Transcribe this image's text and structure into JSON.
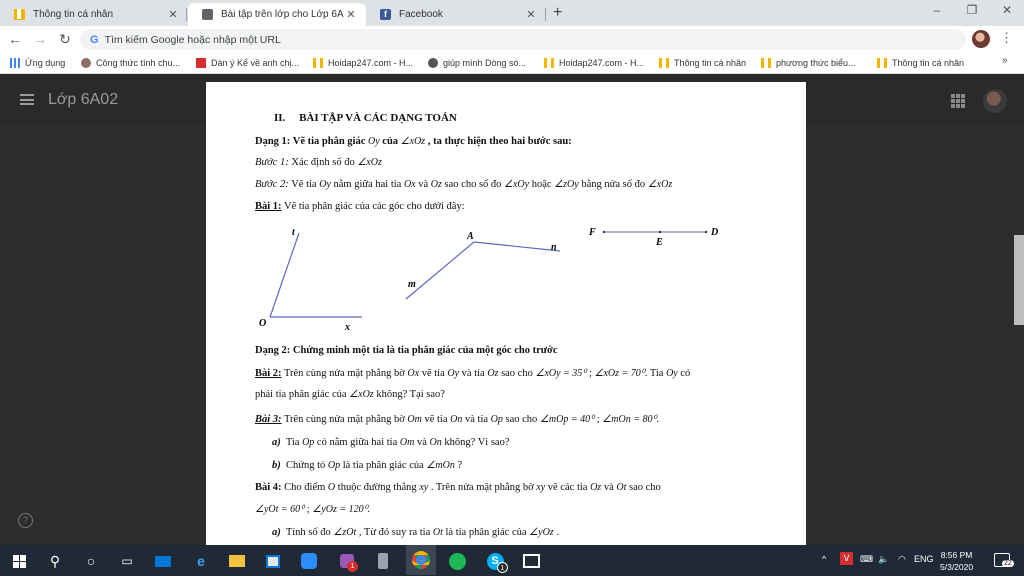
{
  "browser": {
    "tabs": [
      {
        "label": "Thông tin cá nhân"
      },
      {
        "label": "Bài tập trên lớp cho Lớp 6A02"
      },
      {
        "label": "Facebook"
      }
    ],
    "omnibox_placeholder": "Tìm kiếm Google hoặc nhập một URL",
    "bookmarks": [
      {
        "label": "Ứng dụng"
      },
      {
        "label": "Công thức tính chu..."
      },
      {
        "label": "Dàn ý Kể về anh chị..."
      },
      {
        "label": "Hoidap247.com - H..."
      },
      {
        "label": "giúp mình Dòng só..."
      },
      {
        "label": "Hoidap247.com - H..."
      },
      {
        "label": "Thông tin cá nhân"
      },
      {
        "label": "phương thức biểu..."
      },
      {
        "label": "Thông tin cá nhân"
      }
    ]
  },
  "app": {
    "class_name": "Lớp 6A02"
  },
  "document": {
    "section_number": "II.",
    "section_title": "BÀI TẬP VÀ CÁC DẠNG TOÁN",
    "dang1_label": "Dạng 1:",
    "dang1_text": "Vẽ tia phân giác",
    "dang1_oy": "Oy",
    "dang1_cua": "của",
    "dang1_angle": "∠xOz",
    "dang1_rest": ", ta thực hiện theo hai bước sau:",
    "buoc1_label": "Bước 1:",
    "buoc1_text": "Xác định số đo",
    "buoc1_angle": "∠xOz",
    "buoc2_label": "Bước 2:",
    "buoc2_text1": "Vẽ tia",
    "buoc2_oy": "Oy",
    "buoc2_text2": "nằm giữa hai tia",
    "buoc2_ox": "Ox",
    "buoc2_va": "và",
    "buoc2_oz": "Oz",
    "buoc2_text3": "sao cho số đo",
    "buoc2_a1": "∠xOy",
    "buoc2_hoac": "hoặc",
    "buoc2_a2": "∠zOy",
    "buoc2_text4": "bằng nửa số đo",
    "buoc2_a3": "∠xOz",
    "bai1_label": "Bài 1:",
    "bai1_text": "Vẽ tia phân giác của các góc cho dưới đây:",
    "fig": {
      "t": "t",
      "o": "O",
      "x": "x",
      "a": "A",
      "n": "n",
      "m": "m",
      "f": "F",
      "e": "E",
      "d": "D"
    },
    "dang2_label": "Dạng 2:",
    "dang2_text": "Chứng minh một tia là tia phân giác của một góc cho trước",
    "bai2_label": "Bài 2:",
    "bai2_text1": "Trên cùng nửa mặt phẳng bờ",
    "bai2_ox": "Ox",
    "bai2_text2": "vẽ tia",
    "bai2_oy": "Oy",
    "bai2_va": "và tia",
    "bai2_oz": "Oz",
    "bai2_text3": "sao cho",
    "bai2_eq1": "∠xOy = 35⁰",
    "bai2_sep": ";",
    "bai2_eq2": "∠xOz = 70⁰",
    "bai2_text4": ". Tia",
    "bai2_oy2": "Oy",
    "bai2_co": "có",
    "bai2_line2a": "phải tia phân giác của",
    "bai2_angle": "∠xOz",
    "bai2_line2b": "không? Tại sao?",
    "bai3_label": "Bài 3:",
    "bai3_text1": "Trên cùng nửa mặt phẳng bờ",
    "bai3_om": "Om",
    "bai3_text2": "vẽ tia",
    "bai3_on": "On",
    "bai3_va": "và tia",
    "bai3_op": "Op",
    "bai3_text3": "sao cho",
    "bai3_eq1": "∠mOp = 40⁰",
    "bai3_sep": ";",
    "bai3_eq2": "∠mOn = 80⁰",
    "bai3_end": ".",
    "bai3a_label": "a)",
    "bai3a_text1": "Tia",
    "bai3a_op": "Op",
    "bai3a_text2": "có nằm giữa hai tia",
    "bai3a_om": "Om",
    "bai3a_va": "và",
    "bai3a_on": "On",
    "bai3a_text3": "không? Vì sao?",
    "bai3b_label": "b)",
    "bai3b_text1": "Chứng tỏ",
    "bai3b_op": "Op",
    "bai3b_text2": "là tia phân giác của",
    "bai3b_angle": "∠mOn",
    "bai3b_end": "?",
    "bai4_label": "Bài 4:",
    "bai4_text1": "Cho điểm",
    "bai4_o": "O",
    "bai4_text2": "thuộc đường thẳng",
    "bai4_xy": "xy",
    "bai4_text3": ". Trên nửa mặt phẳng bờ",
    "bai4_xy2": "xy",
    "bai4_text4": "vẽ các tia",
    "bai4_oz": "Oz",
    "bai4_va": "và",
    "bai4_ot": "Ot",
    "bai4_text5": "sao cho",
    "bai4_eq1": "∠yOt = 60⁰",
    "bai4_sep": ";",
    "bai4_eq2": "∠yOz = 120⁰.",
    "bai4a_label": "a)",
    "bai4a_text1": "Tính số đo",
    "bai4a_angle": "∠zOt",
    "bai4a_text2": ", Từ đó suy ra tia",
    "bai4a_ot": "Ot",
    "bai4a_text3": "là tia phân giác của",
    "bai4a_angle2": "∠yOz",
    "bai4a_end": "."
  },
  "taskbar": {
    "lang": "ENG",
    "time": "8:56 PM",
    "date": "5/3/2020",
    "notif_count": "22",
    "chrome_badge": "1",
    "skype_badge": "1"
  },
  "colors": {
    "taskbar": "#1f2a36",
    "tab_bar": "#dee1e6",
    "hoidap_yellow": "#f4b400",
    "facebook_blue": "#3b5998"
  }
}
